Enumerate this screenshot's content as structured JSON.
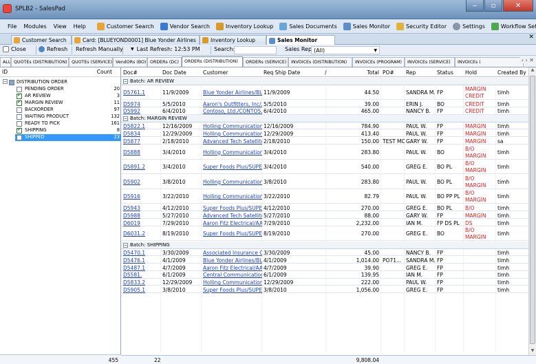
{
  "window": {
    "title": "SPLB2 - SalesPad"
  },
  "menu": [
    "File",
    "Modules",
    "View",
    "Help"
  ],
  "toolbar": [
    {
      "label": "Customer Search",
      "icon": "person-search-icon",
      "color": "#e8a33a"
    },
    {
      "label": "Vendor Search",
      "icon": "truck-icon",
      "color": "#3a7bd5"
    },
    {
      "label": "Inventory Lookup",
      "icon": "box-icon",
      "color": "#d99a2b"
    },
    {
      "label": "Sales Documents",
      "icon": "documents-icon",
      "color": "#6aa5d8"
    },
    {
      "label": "Sales Monitor",
      "icon": "monitor-icon",
      "color": "#5a8fcc"
    },
    {
      "label": "Security Editor",
      "icon": "key-icon",
      "color": "#e0b43a"
    },
    {
      "label": "Settings",
      "icon": "gear-icon",
      "color": "#8896a8"
    },
    {
      "label": "Workflow Setup",
      "icon": "workflow-icon",
      "color": "#4ea84e"
    }
  ],
  "doc_tabs": [
    {
      "label": "Customer Search",
      "icon": "person-search-icon"
    },
    {
      "label": "Card: [BLUEYOND0001] Blue Yonder Airlines",
      "icon": "person-card-icon"
    },
    {
      "label": "Inventory Lookup",
      "icon": "box-icon"
    },
    {
      "label": "Sales Monitor",
      "icon": "monitor-icon"
    }
  ],
  "monitor_toolbar": {
    "close": "Close",
    "refresh": "Refresh",
    "refresh_manually": "Refresh Manually",
    "last_refresh": "Last Refresh: 12:53 PM",
    "search_label": "Search:",
    "sales_rep_label": "Sales Rep:",
    "sales_rep_value": "(All)"
  },
  "view_tabs": [
    "ALL",
    "QUOTEs (DISTRIBUTION)",
    "QUOTEs (SERVICE)",
    "VendORs (BO)",
    "ORDERs (DC)",
    "ORDERs (DISTRIBUTION)",
    "ORDERs (SERVICE)",
    "INVOICEs (DISTRIBUTION)",
    "INVOICEs (PROGRAM)",
    "INVOICEs (SERVICE)",
    "INVOICEs ("
  ],
  "tree": {
    "headers": {
      "id": "ID",
      "count": "Count"
    },
    "root": "DISTRIBUTION ORDER",
    "items": [
      {
        "label": "PENDING ORDER",
        "count": "20",
        "checked": false
      },
      {
        "label": "AR REVIEW",
        "count": "3",
        "checked": true
      },
      {
        "label": "MARGIN REVIEW",
        "count": "11",
        "checked": true
      },
      {
        "label": "BACKORDER",
        "count": "97",
        "checked": false
      },
      {
        "label": "WAITING PRODUCT",
        "count": "132",
        "checked": false
      },
      {
        "label": "READY TO PICK",
        "count": "161",
        "checked": false
      },
      {
        "label": "SHIPPING",
        "count": "8",
        "checked": true
      },
      {
        "label": "SHIPPED",
        "count": "23",
        "checked": false,
        "selected": true
      }
    ],
    "total": "455"
  },
  "grid": {
    "columns": [
      "Doc#",
      "Doc Date",
      "Customer",
      "Req Ship Date",
      "/",
      "Total",
      "PO#",
      "Rep",
      "Status",
      "Hold",
      "Created By"
    ],
    "batches": [
      {
        "name": "Batch: AR REVIEW",
        "rows": [
          {
            "doc": "D5761.1",
            "date": "11/9/2009",
            "customer": "Blue Yonder Airlines/BL...",
            "ship": "11/9/2009",
            "total": "44.50",
            "po": "",
            "rep": "SANDRA M.",
            "status": "FP",
            "hold": [
              "MARGIN",
              "CREDIT"
            ],
            "by": "timh"
          },
          {
            "doc": "D5974",
            "date": "5/5/2010",
            "customer": "Aaron's Outfitters, Inc/...",
            "ship": "5/5/2010",
            "total": "39.00",
            "po": "",
            "rep": "ERIN J.",
            "status": "BO",
            "hold": [
              "CREDIT"
            ],
            "by": "timh"
          },
          {
            "doc": "D5992",
            "date": "6/4/2010",
            "customer": "Contoso, Ltd./CONTOS...",
            "ship": "6/4/2010",
            "total": "465.00",
            "po": "",
            "rep": "NANCY B.",
            "status": "FP",
            "hold": [
              "CREDIT"
            ],
            "by": "timh"
          }
        ]
      },
      {
        "name": "Batch: MARGIN REVIEW",
        "rows": [
          {
            "doc": "D5822.1",
            "date": "12/16/2009",
            "customer": "Holling Communications ...",
            "ship": "12/16/2009",
            "total": "784.90",
            "po": "",
            "rep": "PAUL W.",
            "status": "FP",
            "hold": [
              "MARGIN"
            ],
            "by": "timh"
          },
          {
            "doc": "D5834",
            "date": "12/29/2009",
            "customer": "Holling Communications ...",
            "ship": "12/29/2009",
            "total": "413.40",
            "po": "",
            "rep": "PAUL W.",
            "status": "FP",
            "hold": [
              "MARGIN"
            ],
            "by": "timh"
          },
          {
            "doc": "D5877",
            "date": "2/18/2010",
            "customer": "Advanced Tech Satellite...",
            "ship": "2/18/2010",
            "total": "150.00",
            "po": "TEST MC",
            "rep": "GARY W.",
            "status": "FP",
            "hold": [
              "MARGIN"
            ],
            "by": "sa"
          },
          {
            "doc": "D5888",
            "date": "3/4/2010",
            "customer": "Holling Communications ...",
            "ship": "3/4/2010",
            "total": "283.80",
            "po": "",
            "rep": "PAUL W.",
            "status": "BO",
            "hold": [
              "B/O",
              "MARGIN"
            ],
            "by": "timh"
          },
          {
            "doc": "D5891.2",
            "date": "3/4/2010",
            "customer": "Super Foods Plus/SUPE...",
            "ship": "3/4/2010",
            "total": "540.00",
            "po": "",
            "rep": "GREG E.",
            "status": "BO PL",
            "hold": [
              "B/O",
              "MARGIN"
            ],
            "by": "timh"
          },
          {
            "doc": "D5902",
            "date": "3/8/2010",
            "customer": "Holling Communications ...",
            "ship": "3/8/2010",
            "total": "283.80",
            "po": "",
            "rep": "PAUL W.",
            "status": "BO PL",
            "hold": [
              "B/O",
              "MARGIN"
            ],
            "by": "timh"
          },
          {
            "doc": "D5916",
            "date": "3/22/2010",
            "customer": "Holling Communications ...",
            "ship": "3/22/2010",
            "total": "82.79",
            "po": "",
            "rep": "PAUL W.",
            "status": "BO PP PL",
            "hold": [
              "B/O",
              "MARGIN"
            ],
            "by": "timh"
          },
          {
            "doc": "D5943",
            "date": "4/12/2010",
            "customer": "Super Foods Plus/SUPE...",
            "ship": "4/12/2010",
            "total": "270.00",
            "po": "",
            "rep": "GREG E.",
            "status": "BO PL",
            "hold": [
              "B/O"
            ],
            "by": "timh"
          },
          {
            "doc": "D5988",
            "date": "5/27/2010",
            "customer": "Advanced Tech Satellite...",
            "ship": "5/27/2010",
            "total": "88.00",
            "po": "",
            "rep": "GARY W.",
            "status": "FP",
            "hold": [
              "MARGIN"
            ],
            "by": "timh"
          },
          {
            "doc": "D6019",
            "date": "7/29/2010",
            "customer": "Aaron Fitz Electrical/AA...",
            "ship": "7/29/2010",
            "total": "2,232.00",
            "po": "",
            "rep": "IAN M.",
            "status": "FP DS PL",
            "hold": [
              "DS"
            ],
            "by": "timh"
          },
          {
            "doc": "D6031.2",
            "date": "8/19/2010",
            "customer": "Super Foods Plus/SUPE...",
            "ship": "8/19/2010",
            "total": "270.00",
            "po": "",
            "rep": "GREG E.",
            "status": "BO",
            "hold": [
              "B/O",
              "MARGIN"
            ],
            "by": "timh"
          }
        ]
      },
      {
        "name": "Batch: SHIPPING",
        "rows": [
          {
            "doc": "D5470.1",
            "date": "3/30/2009",
            "customer": "Associated Insurance C...",
            "ship": "3/30/2009",
            "total": "45.00",
            "po": "",
            "rep": "NANCY B.",
            "status": "FP",
            "hold": [],
            "by": "timh"
          },
          {
            "doc": "D5476.1",
            "date": "4/1/2009",
            "customer": "Blue Yonder Airlines/BL...",
            "ship": "4/1/2009",
            "total": "1,014.00",
            "po": "PO71...",
            "rep": "SANDRA M.",
            "status": "FP",
            "hold": [],
            "by": "timh"
          },
          {
            "doc": "D5487.1",
            "date": "4/7/2009",
            "customer": "Aaron Fitz Electrical/AA...",
            "ship": "4/7/2009",
            "total": "39.90",
            "po": "",
            "rep": "GREG E.",
            "status": "FP",
            "hold": [],
            "by": "timh"
          },
          {
            "doc": "D5581.",
            "date": "6/1/2009",
            "customer": "Central Communications...",
            "ship": "6/1/2009",
            "total": "139.95",
            "po": "",
            "rep": "IAN M.",
            "status": "FP",
            "hold": [],
            "by": "timh"
          },
          {
            "doc": "D5833.2",
            "date": "12/29/2009",
            "customer": "Holling Communications ...",
            "ship": "12/29/2009",
            "total": "222.00",
            "po": "",
            "rep": "PAUL W.",
            "status": "FP",
            "hold": [],
            "by": "timh"
          },
          {
            "doc": "D5905.1",
            "date": "3/8/2010",
            "customer": "Super Foods Plus/SUPE...",
            "ship": "3/8/2010",
            "total": "1,056.00",
            "po": "",
            "rep": "GREG E.",
            "status": "FP",
            "hold": [],
            "by": "timh"
          }
        ]
      }
    ],
    "footer": {
      "count": "22",
      "total": "9,808.04"
    }
  },
  "colors": {
    "accent": "#3399ff",
    "link": "#1a3fd0",
    "hold": "#e02020"
  }
}
